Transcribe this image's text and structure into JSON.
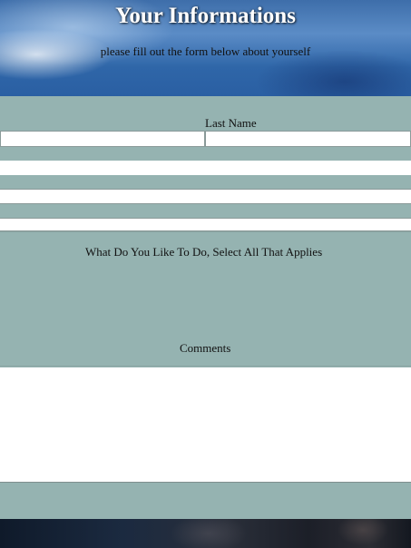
{
  "header": {
    "title": "Your Informations",
    "subtitle": "please fill out the form below about yourself"
  },
  "form": {
    "last_name_label": "Last Name",
    "first_name_value": "",
    "last_name_value": "",
    "field_3_value": "",
    "field_4_value": "",
    "activities_label": "What Do You Like To Do, Select All That Applies",
    "comments_label": "Comments",
    "comments_value": ""
  },
  "colors": {
    "panel": "#95b3b1",
    "field": "#ffffff",
    "header_sky": "#3e6eaa",
    "footer_dark": "#1b2a40"
  }
}
